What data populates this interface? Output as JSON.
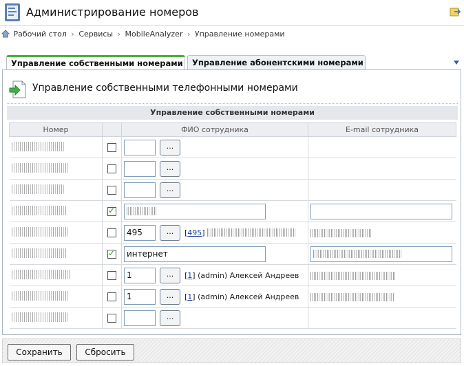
{
  "header": {
    "title": "Администрирование номеров"
  },
  "breadcrumb": [
    "Рабочий стол",
    "Сервисы",
    "MobileAnalyzer",
    "Управление номерами"
  ],
  "tabs": [
    {
      "label": "Управление собственными номерами",
      "active": true
    },
    {
      "label": "Управление абонентскими номерами",
      "active": false
    }
  ],
  "panel": {
    "title": "Управление собственными телефонными номерами",
    "grid_caption": "Управление собственными номерами",
    "columns": {
      "number": "Номер",
      "check": "",
      "fio": "ФИО сотрудника",
      "email": "E-mail сотрудника"
    },
    "picker_label": "...",
    "rows": [
      {
        "checked": false,
        "fio_value": "",
        "email_value": "",
        "link": "",
        "person": ""
      },
      {
        "checked": false,
        "fio_value": "",
        "email_value": "",
        "link": "",
        "person": ""
      },
      {
        "checked": false,
        "fio_value": "",
        "email_value": "",
        "link": "",
        "person": ""
      },
      {
        "checked": true,
        "fio_value": "",
        "email_value": "",
        "link": "",
        "person": ""
      },
      {
        "checked": false,
        "fio_value": "495",
        "email_value": "",
        "link": "495",
        "person": ""
      },
      {
        "checked": true,
        "fio_value": "интернет",
        "email_value": "",
        "link": "",
        "person": ""
      },
      {
        "checked": false,
        "fio_value": "1",
        "email_value": "",
        "link": "1",
        "person": "(admin) Алексей Андреев"
      },
      {
        "checked": false,
        "fio_value": "1",
        "email_value": "",
        "link": "1",
        "person": "(admin) Алексей Андреев"
      },
      {
        "checked": false,
        "fio_value": "",
        "email_value": "",
        "link": "",
        "person": ""
      }
    ]
  },
  "footer": {
    "save_label": "Сохранить",
    "reset_label": "Сбросить"
  }
}
